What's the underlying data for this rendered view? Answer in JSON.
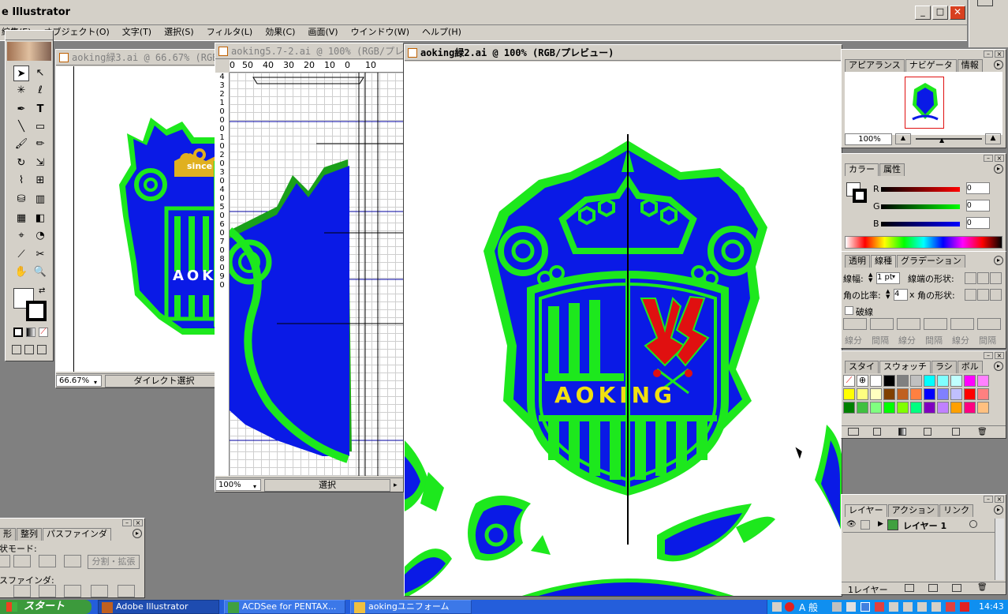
{
  "app": {
    "title": "e Illustrator",
    "menu": [
      "編集(E)",
      "オブジェクト(O)",
      "文字(T)",
      "選択(S)",
      "フィルタ(L)",
      "効果(C)",
      "画面(V)",
      "ウインドウ(W)",
      "ヘルプ(H)"
    ]
  },
  "documents": {
    "doc1": {
      "title": "aoking緑3.ai @ 66.67% (RGB/",
      "zoom": "66.67%",
      "status": "ダイレクト選択",
      "logo_text": "AOKI",
      "since": "since"
    },
    "doc2": {
      "title": "aoking5.7-2.ai @ 100% (RGB/プレ",
      "zoom": "100%",
      "status": "選択",
      "ruler_top": [
        "0",
        "50",
        "40",
        "30",
        "20",
        "10",
        "0",
        "10"
      ],
      "ruler_left": [
        "4",
        "3",
        "2",
        "1",
        "0",
        "0",
        "0",
        "1",
        "0",
        "2",
        "0",
        "3",
        "0",
        "4",
        "0",
        "5",
        "0",
        "6",
        "0",
        "7",
        "0",
        "8",
        "0",
        "9",
        "0"
      ]
    },
    "doc3": {
      "title": "aoking緑2.ai @ 100% (RGB/プレビュー)",
      "logo_text": "AOKING",
      "zoom": "100%"
    }
  },
  "panels": {
    "navigator": {
      "tabs": [
        "アピアランス",
        "ナビゲータ",
        "情報"
      ],
      "zoom": "100%"
    },
    "color": {
      "tabs": [
        "カラー",
        "属性"
      ],
      "r_label": "R",
      "g_label": "G",
      "b_label": "B",
      "r": "0",
      "g": "0",
      "b": "0"
    },
    "stroke": {
      "tabs": [
        "透明",
        "線種",
        "グラデーション"
      ],
      "weight_label": "線幅:",
      "weight": "1 pt",
      "cap_label": "線端の形状:",
      "miter_label": "角の比率:",
      "miter": "4",
      "x": "x",
      "join_label": "角の形状:",
      "dashed_label": "破線",
      "dash_labels": [
        "線分",
        "間隔",
        "線分",
        "間隔",
        "線分",
        "間隔"
      ]
    },
    "swatches": {
      "tabs": [
        "スタイ",
        "スウォッチ",
        "ラシ",
        "ボル"
      ]
    },
    "layers": {
      "tabs": [
        "レイヤー",
        "アクション",
        "リンク"
      ],
      "layer_name": "レイヤー 1",
      "footer": "1レイヤー"
    },
    "pathfinder": {
      "tabs": [
        "形",
        "整列",
        "パスファインダ"
      ],
      "shape_mode": "状モード:",
      "expand": "分割・拡張",
      "pathfinder_label": "スファインダ:"
    }
  },
  "taskbar": {
    "start": "スタート",
    "items": [
      "Adobe Illustrator",
      "ACDSee for PENTAX...",
      "aokingユニフォーム"
    ],
    "tray_ime": "A 般",
    "clock": "14:43"
  },
  "colors": {
    "logo_blue": "#0a1ae6",
    "logo_green": "#1de81d",
    "logo_yellow": "#f0e010",
    "logo_red": "#e01010",
    "title_active": "#0a246a",
    "taskbar": "#245edb",
    "start_green": "#3c9a3c"
  }
}
